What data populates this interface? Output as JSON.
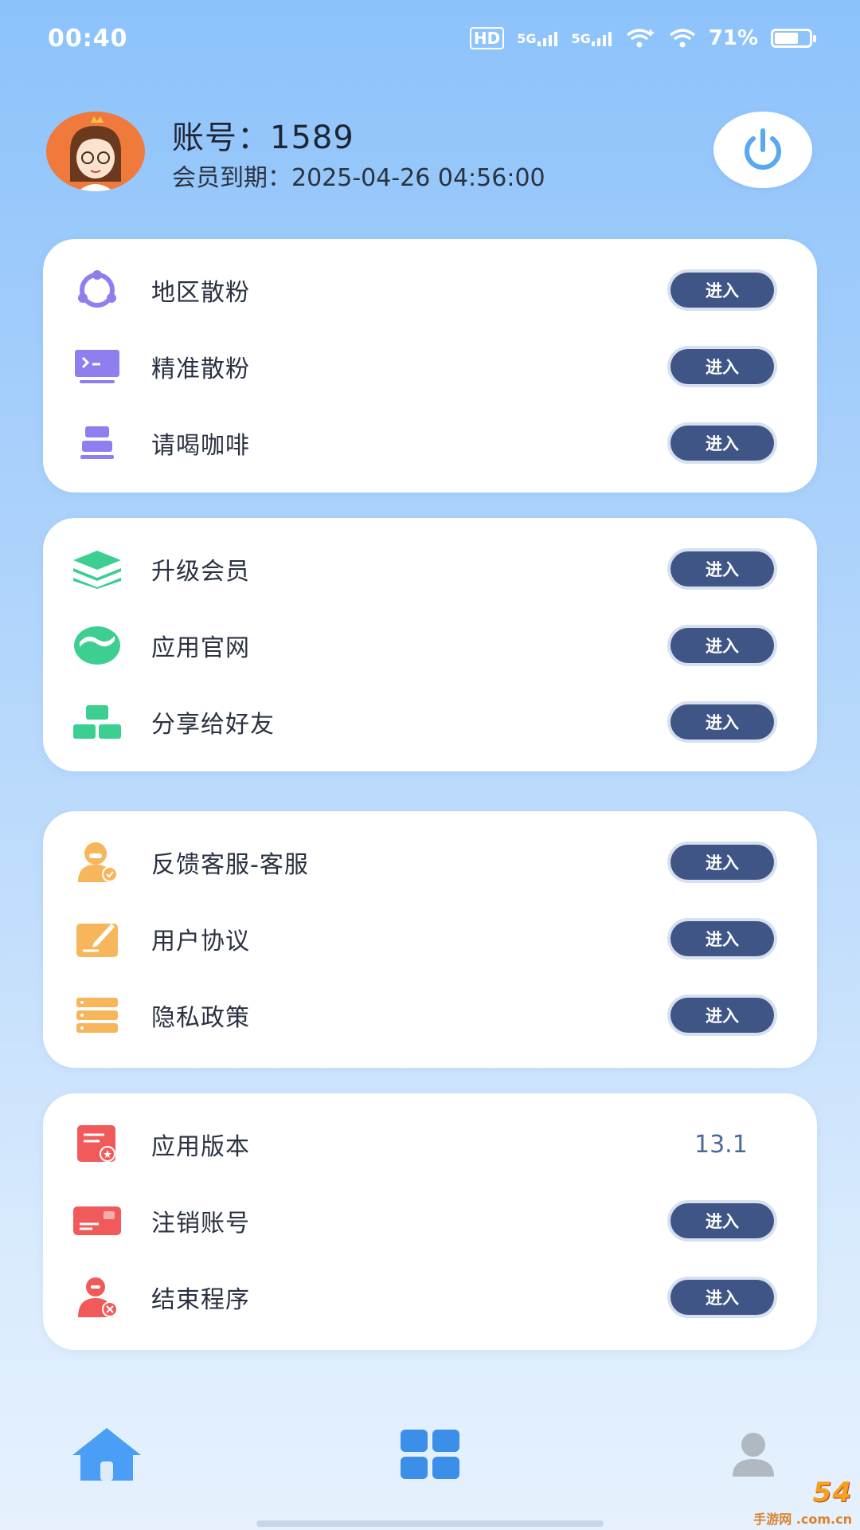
{
  "status_bar": {
    "time": "00:40",
    "hd": "HD",
    "net1": "5G",
    "net2": "5G",
    "battery_text": "71%",
    "battery_level": 0.71
  },
  "header": {
    "account_text": "账号：1589",
    "expiry_text": "会员到期：2025-04-26 04:56:00"
  },
  "enter_label": "进入",
  "groups": [
    {
      "items": [
        {
          "label": "地区散粉",
          "icon": "share-nodes-icon",
          "color": "#8e7ff0"
        },
        {
          "label": "精准散粉",
          "icon": "terminal-icon",
          "color": "#8e7ff0"
        },
        {
          "label": "请喝咖啡",
          "icon": "coffee-stack-icon",
          "color": "#8e7ff0"
        }
      ]
    },
    {
      "items": [
        {
          "label": "升级会员",
          "icon": "layers-icon",
          "color": "#3ccf91"
        },
        {
          "label": "应用官网",
          "icon": "website-wave-icon",
          "color": "#3ccf91"
        },
        {
          "label": "分享给好友",
          "icon": "blocks-share-icon",
          "color": "#3ccf91"
        }
      ]
    },
    {
      "items": [
        {
          "label": "反馈客服-客服",
          "icon": "customer-service-icon",
          "color": "#f7b55c"
        },
        {
          "label": "用户协议",
          "icon": "agreement-pen-icon",
          "color": "#f7b55c"
        },
        {
          "label": "隐私政策",
          "icon": "privacy-list-icon",
          "color": "#f7b55c"
        }
      ]
    },
    {
      "items": [
        {
          "label": "应用版本",
          "icon": "version-doc-icon",
          "color": "#f05a5a",
          "value": "13.1"
        },
        {
          "label": "注销账号",
          "icon": "card-cancel-icon",
          "color": "#f05a5a"
        },
        {
          "label": "结束程序",
          "icon": "exit-user-icon",
          "color": "#f05a5a"
        }
      ]
    }
  ],
  "colors": {
    "enter_button": "#3f5586",
    "home_icon": "#4a9ef5",
    "grid_icon": "#3c8fe8",
    "profile_icon": "#b0b8c2"
  },
  "bottom_nav": {
    "items": [
      {
        "icon": "home-icon"
      },
      {
        "icon": "grid-icon"
      },
      {
        "icon": "profile-icon"
      }
    ]
  },
  "watermark": {
    "main": "54",
    "sub": "手游网 .com.cn"
  }
}
